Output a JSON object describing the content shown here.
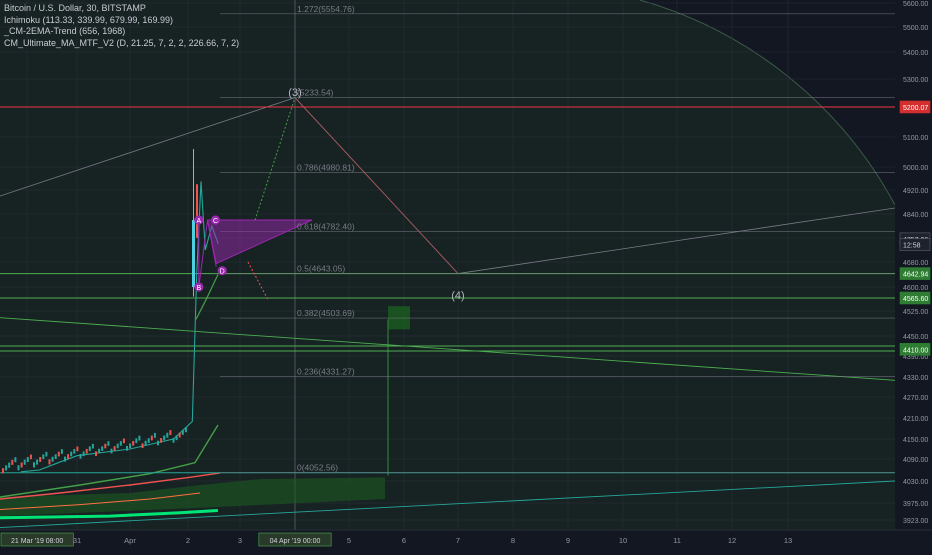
{
  "legend": {
    "symbol": "Bitcoin / U.S. Dollar, 30, BITSTAMP",
    "ind1": "Ichimoku (113.33, 339.99, 679.99, 169.99)",
    "ind2": "_CM-2EMA-Trend (656, 1968)",
    "ind3": "CM_Ultimate_MA_MTF_V2 (D, 21.25, 7, 2, 2, 226.66, 7, 2)"
  },
  "colors": {
    "background": "#131722",
    "grid": "#2a2e39",
    "axis_text": "#9598a1",
    "fib": "#787b86",
    "resistance": "#f23645",
    "support": "#4caf50",
    "pattern": "#9c27b0",
    "wave": "#b2b5be",
    "cloud": "#1b5e20",
    "ema_green": "#43a047",
    "ema_red": "#ef5350",
    "candle_up": "#26a69a",
    "candle_down": "#ef5350"
  },
  "chart_data": {
    "type": "candlestick",
    "title": "Bitcoin / U.S. Dollar, 30, BITSTAMP",
    "xlabel": "",
    "ylabel": "",
    "ylim": [
      3890,
      5620
    ],
    "x_ticks": [
      "21 Mar '19  08:00",
      "31",
      "Apr",
      "2",
      "3",
      "04 Apr '19  00:00",
      "5",
      "6",
      "7",
      "8",
      "9",
      "10",
      "11",
      "12",
      "13"
    ],
    "x_tick_dates": [
      "2019-03-27",
      "2019-03-31",
      "2019-04-01",
      "2019-04-02",
      "2019-04-03",
      "2019-04-04",
      "2019-04-05",
      "2019-04-06",
      "2019-04-07",
      "2019-04-08",
      "2019-04-09",
      "2019-04-10",
      "2019-04-11",
      "2019-04-12",
      "2019-04-13"
    ],
    "x_highlighted": [
      "21 Mar '19  08:00",
      "04 Apr '19  00:00"
    ],
    "y_ticks": [
      3923,
      3975,
      4030,
      4090,
      4150,
      4210,
      4270,
      4330,
      4390,
      4450,
      4525,
      4600,
      4680,
      4760,
      4840,
      4920,
      5000,
      5100,
      5200,
      5300,
      5400,
      5500,
      5600
    ],
    "y_tick_labels": [
      "3923.00",
      "3975.00",
      "4030.00",
      "4090.00",
      "4150.00",
      "4210.00",
      "4270.00",
      "4330.00",
      "4390.00",
      "4450.00",
      "4525.00",
      "4600.00",
      "4680.00",
      "4760.00",
      "4840.00",
      "4920.00",
      "5000.00",
      "5100.00",
      "5200.00",
      "5300.00",
      "5400.00",
      "5500.00",
      "5600.00"
    ],
    "fib_levels": [
      {
        "label": "1.272(5554.76)",
        "value": 5554.76
      },
      {
        "label": "(5233.54)",
        "value": 5233.54
      },
      {
        "label": "0.786(4980.81)",
        "value": 4980.81
      },
      {
        "label": "0.618(4782.40)",
        "value": 4782.4
      },
      {
        "label": "0.5(4643.05)",
        "value": 4643.05
      },
      {
        "label": "0.382(4503.69)",
        "value": 4503.69
      },
      {
        "label": "0.236(4331.27)",
        "value": 4331.27
      },
      {
        "label": "0(4052.56)",
        "value": 4052.56
      }
    ],
    "price_badges": [
      {
        "label": "5200.07",
        "value": 5200.07,
        "kind": "red"
      },
      {
        "label": "4757.06",
        "value": 4757.06,
        "kind": "dark"
      },
      {
        "label": "12:58",
        "value": 4738,
        "kind": "dark"
      },
      {
        "label": "4642.94",
        "value": 4642.94,
        "kind": "green"
      },
      {
        "label": "4565.60",
        "value": 4565.6,
        "kind": "green"
      },
      {
        "label": "4410.00",
        "value": 4410.0,
        "kind": "green"
      }
    ],
    "horizontal_lines": [
      {
        "value": 5200.07,
        "kind": "red"
      },
      {
        "value": 4642.94,
        "kind": "green"
      },
      {
        "value": 4565.6,
        "kind": "green"
      },
      {
        "value": 4420,
        "kind": "green"
      },
      {
        "value": 4405,
        "kind": "green"
      },
      {
        "value": 4052.56,
        "kind": "teal"
      }
    ],
    "pattern_points": [
      {
        "label": "A",
        "date": "2019-04-02T05:00",
        "price": 4820
      },
      {
        "label": "C",
        "date": "2019-04-02T09:00",
        "price": 4820
      },
      {
        "label": "B",
        "date": "2019-04-02T05:00",
        "price": 4600
      },
      {
        "label": "D",
        "date": "2019-04-02T13:00",
        "price": 4665
      }
    ],
    "wave_labels": [
      {
        "label": "(3)",
        "date": "2019-04-04T00:00",
        "price": 5240
      },
      {
        "label": "(4)",
        "date": "2019-04-07T00:00",
        "price": 4620
      }
    ],
    "price_path": [
      {
        "date": "2019-03-26T12:00",
        "price": 4055
      },
      {
        "date": "2019-03-28T00:00",
        "price": 4060
      },
      {
        "date": "2019-03-29T12:00",
        "price": 4080
      },
      {
        "date": "2019-03-31T00:00",
        "price": 4100
      },
      {
        "date": "2019-04-01T00:00",
        "price": 4120
      },
      {
        "date": "2019-04-01T18:00",
        "price": 4150
      },
      {
        "date": "2019-04-02T02:00",
        "price": 4200
      },
      {
        "date": "2019-04-02T04:00",
        "price": 4640
      },
      {
        "date": "2019-04-02T06:00",
        "price": 4950
      },
      {
        "date": "2019-04-02T08:00",
        "price": 4720
      },
      {
        "date": "2019-04-02T11:00",
        "price": 4800
      },
      {
        "date": "2019-04-02T14:00",
        "price": 4740
      }
    ]
  }
}
